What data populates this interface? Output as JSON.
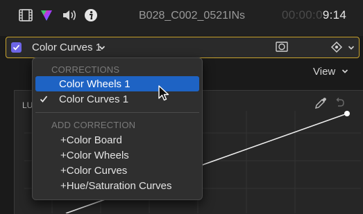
{
  "toolbar": {
    "clip_name": "B028_C002_0521INs",
    "timecode_dim": "00:00:0",
    "timecode_lit": "9:14",
    "icons": [
      "film-strip-icon",
      "color-triangle-icon",
      "speaker-icon",
      "info-icon"
    ]
  },
  "correction_bar": {
    "selected_label": "Color Curves 1",
    "checked": true,
    "accent_color": "#c9a42e",
    "checkbox_color": "#6d65e8"
  },
  "view": {
    "label": "View"
  },
  "curve_panel": {
    "title": "LU"
  },
  "menu": {
    "corrections_header": "CORRECTIONS",
    "corrections": [
      {
        "label": "Color Wheels 1",
        "highlighted": true,
        "checked": false
      },
      {
        "label": "Color Curves 1",
        "highlighted": false,
        "checked": true
      }
    ],
    "add_header": "ADD CORRECTION",
    "add_items": [
      "+Color Board",
      "+Color Wheels",
      "+Color Curves",
      "+Hue/Saturation Curves"
    ],
    "highlight_color": "#1e63c4"
  }
}
